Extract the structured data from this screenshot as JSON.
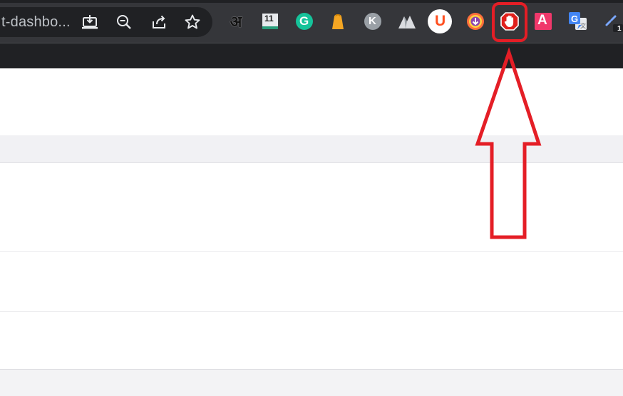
{
  "omnibox": {
    "url_text": "t-dashbo...",
    "actions": [
      {
        "name": "install-app-icon"
      },
      {
        "name": "zoom-out-icon"
      },
      {
        "name": "share-icon"
      },
      {
        "name": "bookmark-star-icon"
      }
    ]
  },
  "extensions": [
    {
      "name": "hindi-input-extension-icon",
      "glyph": "अ"
    },
    {
      "name": "calendar-11-extension-icon",
      "glyph": "11"
    },
    {
      "name": "grammarly-extension-icon",
      "glyph": "G"
    },
    {
      "name": "orange-bag-extension-icon"
    },
    {
      "name": "k-extension-icon",
      "glyph": "K"
    },
    {
      "name": "mountain-extension-icon"
    },
    {
      "name": "u-extension-icon",
      "glyph": "U"
    },
    {
      "name": "download-extension-icon"
    },
    {
      "name": "adblock-hand-extension-icon"
    },
    {
      "name": "a-extension-icon",
      "glyph": "A"
    },
    {
      "name": "google-translate-extension-icon",
      "glyph": "G"
    },
    {
      "name": "link-extension-icon",
      "glyph": "1"
    }
  ],
  "colors": {
    "toolbar_bg": "#35363a",
    "omnibox_bg": "#202124",
    "highlight_red": "#e41e26",
    "adblock_red": "#e0201c"
  }
}
